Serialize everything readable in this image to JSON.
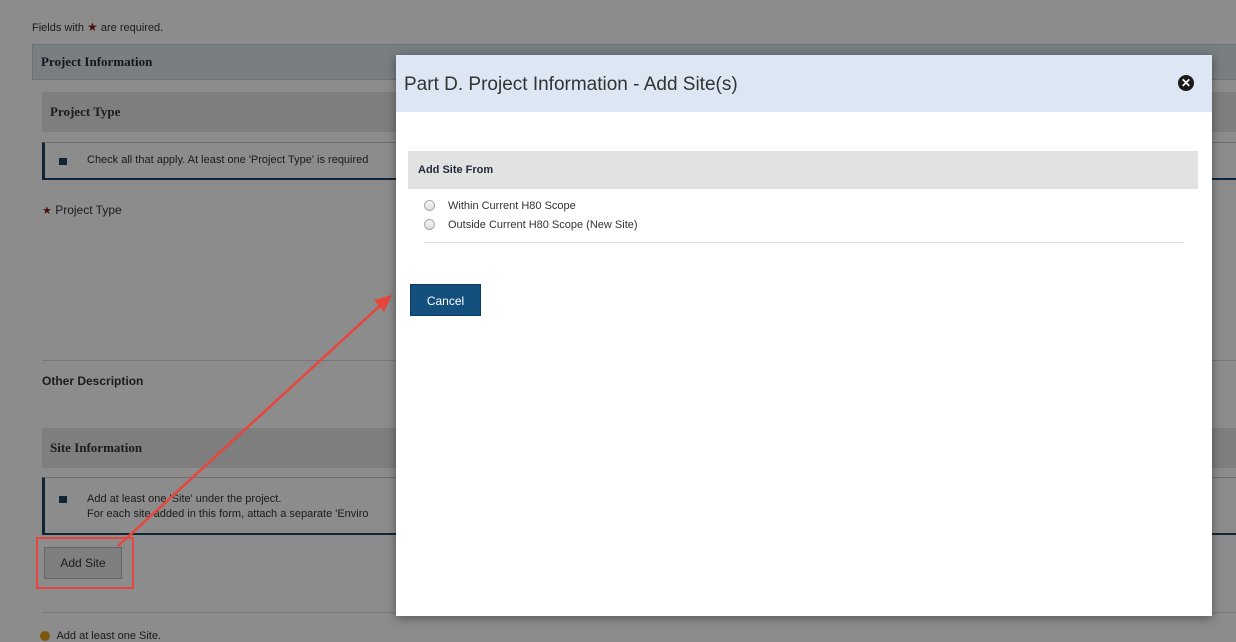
{
  "page": {
    "required_note_prefix": "Fields with",
    "required_note_suffix": "are required.",
    "project_info_title": "Project Information",
    "project_type_section": "Project Type",
    "project_type_callout": "Check all that apply. At least one 'Project Type' is required",
    "project_type_field_label": "Project Type",
    "other_description_label": "Other Description",
    "site_info_section": "Site Information",
    "site_callout_line1": "Add at least one 'Site' under the project.",
    "site_callout_line2": "For each site added in this form, attach a separate 'Enviro",
    "add_site_button": "Add Site",
    "bottom_note": "Add at least one Site."
  },
  "modal": {
    "title": "Part D. Project Information - Add Site(s)",
    "close_glyph": "✕",
    "add_site_from_label": "Add Site From",
    "options": [
      {
        "label": "Within Current H80 Scope",
        "selected": false
      },
      {
        "label": "Outside Current H80 Scope (New Site)",
        "selected": false
      }
    ],
    "cancel_button": "Cancel"
  },
  "colors": {
    "primary_button": "#14507e",
    "annotation": "#e8453c",
    "modal_header": "#dce7f3"
  }
}
